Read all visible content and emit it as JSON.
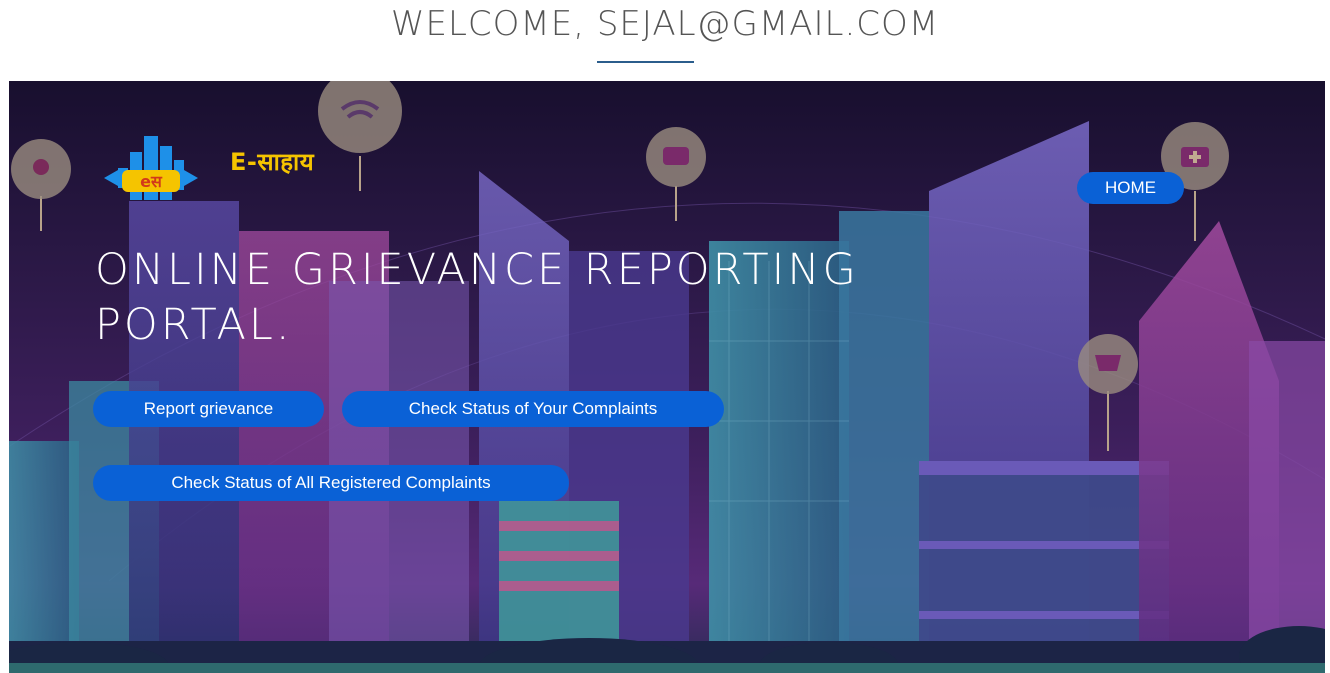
{
  "header": {
    "welcome_text": "WELCOME, SEJAL@GMAIL.COM"
  },
  "brand": {
    "logo_text": "eस",
    "name": "E-साहाय"
  },
  "nav": {
    "home_label": "HOME"
  },
  "hero": {
    "title_line1": "ONLINE GRIEVANCE REPORTING",
    "title_line2": "PORTAL."
  },
  "actions": {
    "report_label": "Report grievance",
    "status_yours_label": "Check Status of Your Complaints",
    "status_all_label": "Check Status of All Registered Complaints"
  },
  "colors": {
    "accent": "#0a61d6",
    "brand_yellow": "#f5c400",
    "background_top": "#180f2e",
    "background_bottom": "#572a78"
  },
  "icons": [
    "location-pin-icon",
    "wifi-pin-icon",
    "chat-pin-icon",
    "medical-kit-pin-icon",
    "shopping-cart-pin-icon"
  ]
}
